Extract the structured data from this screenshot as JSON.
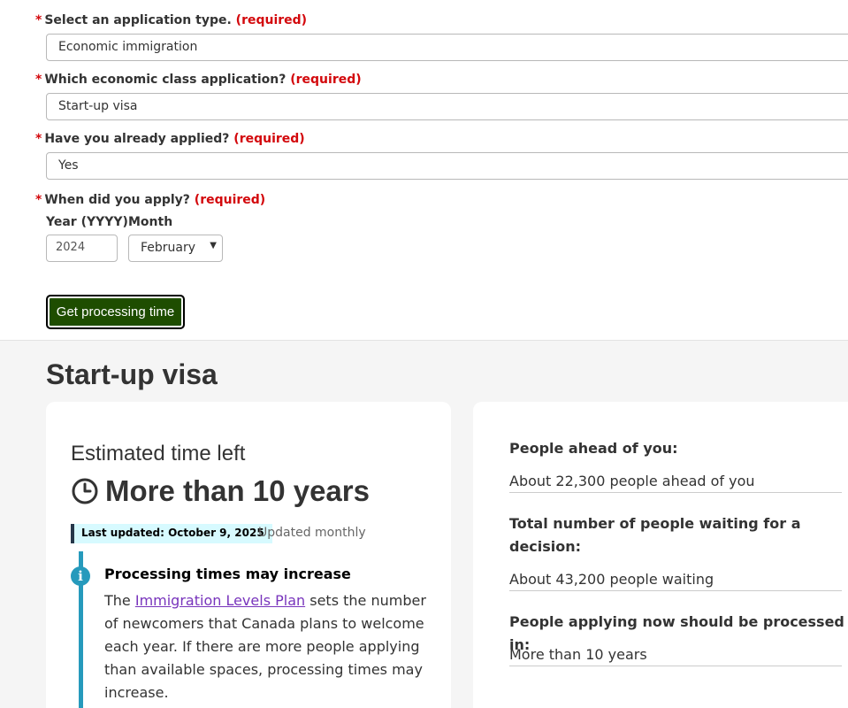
{
  "form": {
    "required_star": "*",
    "required_tag": "(required)",
    "app_type": {
      "label": "Select an application type.",
      "value": "Economic immigration"
    },
    "econ_class": {
      "label": "Which economic class application?",
      "value": "Start-up visa"
    },
    "applied": {
      "label": "Have you already applied?",
      "value": "Yes"
    },
    "when_applied": {
      "label": "When did you apply?",
      "year_label": "Year (YYYY)",
      "year_value": "2024",
      "month_label": "Month",
      "month_value": "February"
    },
    "submit_label": "Get processing time"
  },
  "results": {
    "title": "Start-up visa",
    "estimate": {
      "label": "Estimated time left",
      "icon": "clock-icon",
      "value": "More than 10 years"
    },
    "last_updated": "Last updated: October 9, 2025",
    "update_frequency": "Updated monthly",
    "notice": {
      "icon": "info-icon",
      "title": "Processing times may increase",
      "text_before": "The ",
      "link_text": "Immigration Levels Plan",
      "text_after": " sets the number of newcomers that Canada plans to welcome each year. If there are more people applying than available spaces, processing times may increase."
    },
    "stats": {
      "ahead_label": "People ahead of you:",
      "ahead_value": "About 22,300 people ahead of you",
      "waiting_label": "Total number of people waiting for a decision:",
      "waiting_value": "About 43,200 people waiting",
      "new_label": "People applying now should be processed in:",
      "new_value": "More than 10 years"
    }
  },
  "colors": {
    "required": "#d3080c",
    "button_bg": "#1e4d00",
    "info_accent": "#269abc",
    "link": "#7834bc",
    "badge_bg": "#d7faff"
  }
}
